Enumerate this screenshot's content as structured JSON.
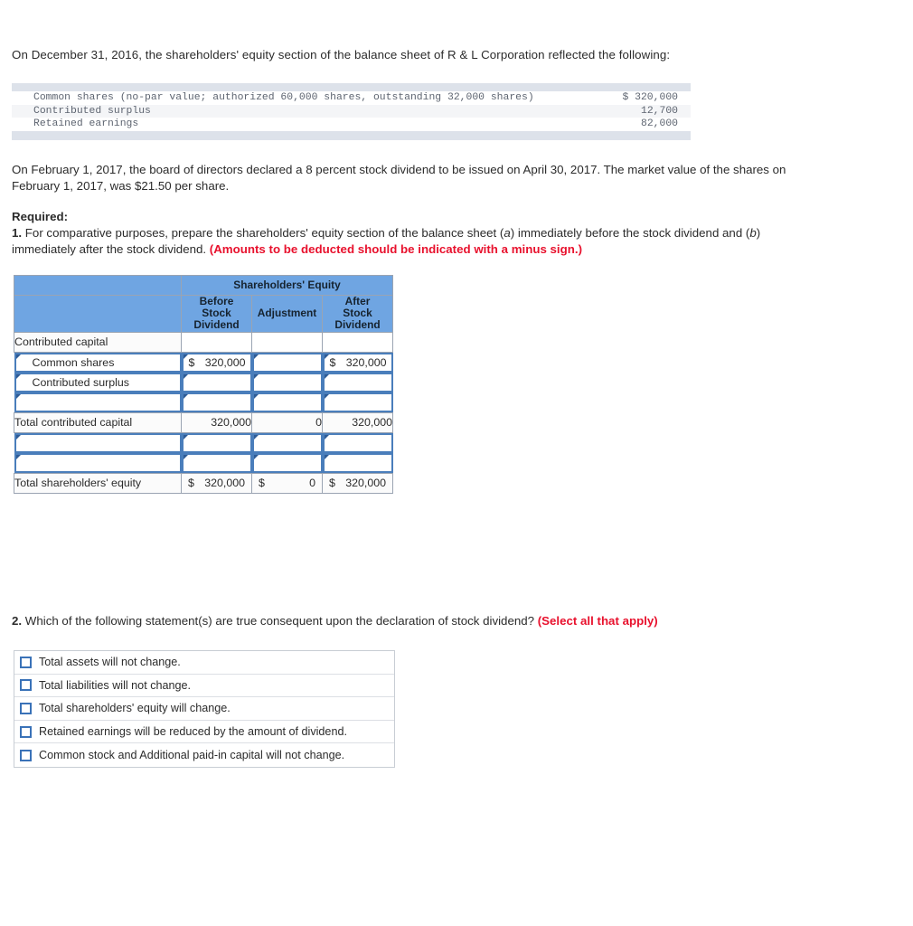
{
  "intro": {
    "text": "On December 31, 2016, the shareholders' equity section of the balance sheet of R & L Corporation reflected the following:"
  },
  "balance_block": {
    "rows": [
      {
        "label": "Common shares (no-par value; authorized 60,000 shares, outstanding 32,000 shares)",
        "amount": "$ 320,000"
      },
      {
        "label": "Contributed surplus",
        "amount": "12,700"
      },
      {
        "label": "Retained earnings",
        "amount": "82,000"
      }
    ]
  },
  "paragraph2": {
    "text": "On February 1, 2017, the board of directors declared a 8 percent stock dividend to be issued on April 30, 2017. The market value of the shares on February 1, 2017, was $21.50 per share."
  },
  "required": {
    "heading": "Required:",
    "item_number": "1.",
    "text_part1": "For comparative purposes, prepare the shareholders' equity section of the balance sheet (",
    "label_a": "a",
    "text_part2": ") immediately before the stock dividend and (",
    "label_b": "b",
    "text_part3": ") immediately after the stock dividend.",
    "note": "(Amounts to be deducted should be indicated with a minus sign.)"
  },
  "sheet": {
    "group_header": "Shareholders' Equity",
    "columns": [
      "Before Stock Dividend",
      "Adjustment",
      "After Stock Dividend"
    ],
    "column_lines": [
      [
        "Before",
        "Stock",
        "Dividend"
      ],
      [
        "Adjustment"
      ],
      [
        "After",
        "Stock",
        "Dividend"
      ]
    ],
    "rows": [
      {
        "type": "static",
        "label": "Contributed capital",
        "before": "",
        "adjustment": "",
        "after": ""
      },
      {
        "type": "input",
        "label": "Common shares",
        "before_dollar": "$",
        "before": "320,000",
        "adjustment": "",
        "after_dollar": "$",
        "after": "320,000"
      },
      {
        "type": "input",
        "label": "Contributed surplus",
        "before": "",
        "adjustment": "",
        "after": ""
      },
      {
        "type": "input",
        "label": "",
        "before": "",
        "adjustment": "",
        "after": ""
      },
      {
        "type": "static",
        "label": "Total contributed capital",
        "before": "320,000",
        "adjustment": "0",
        "after": "320,000"
      },
      {
        "type": "input",
        "label": "",
        "before": "",
        "adjustment": "",
        "after": ""
      },
      {
        "type": "input",
        "label": "",
        "before": "",
        "adjustment": "",
        "after": ""
      },
      {
        "type": "static-total",
        "label": "Total shareholders' equity",
        "before_dollar": "$",
        "before": "320,000",
        "adjustment_dollar": "$",
        "adjustment": "0",
        "after_dollar": "$",
        "after": "320,000"
      }
    ]
  },
  "question2": {
    "number": "2.",
    "text": "Which of the following statement(s) are true consequent upon the declaration of stock dividend?",
    "note": "(Select all that apply)",
    "options": [
      {
        "label": "Total assets will not change.",
        "checked": false
      },
      {
        "label": "Total liabilities will not change.",
        "checked": false
      },
      {
        "label": "Total shareholders' equity will change.",
        "checked": false
      },
      {
        "label": "Retained earnings will be reduced by the amount of dividend.",
        "checked": false
      },
      {
        "label": "Common stock and Additional paid-in capital will not change.",
        "checked": false
      }
    ]
  },
  "colors": {
    "header_blue": "#6fa5e2",
    "input_border": "#4a7ebb",
    "note_red": "#e8112d",
    "band_gray": "#dde2ea"
  }
}
